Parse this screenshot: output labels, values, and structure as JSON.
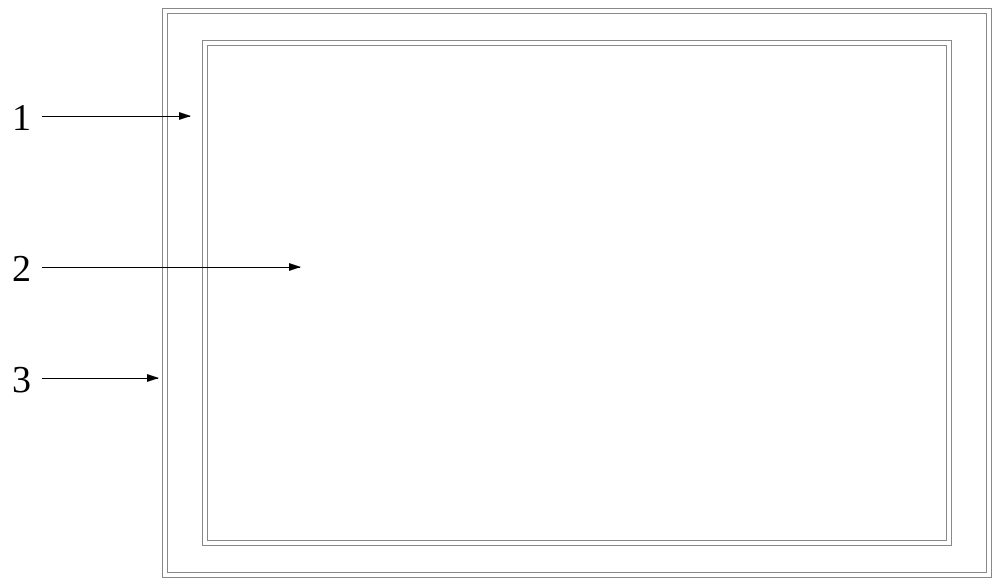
{
  "labels": {
    "label1": "1",
    "label2": "2",
    "label3": "3"
  }
}
